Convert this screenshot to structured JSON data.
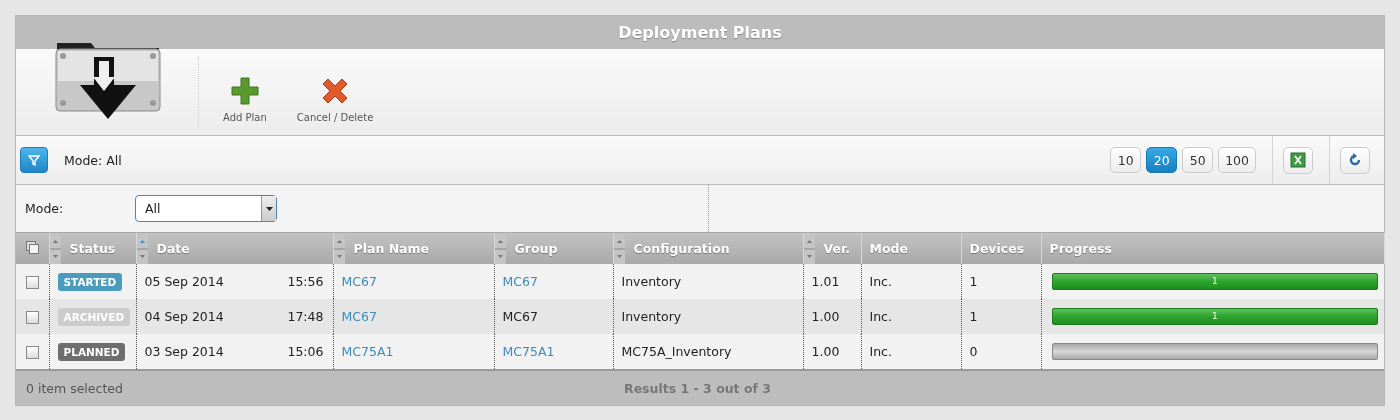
{
  "window": {
    "title": "Deployment Plans"
  },
  "toolbar": [
    {
      "kind": "add",
      "label": "Add Plan"
    },
    {
      "kind": "delete",
      "label": "Cancel / Delete"
    }
  ],
  "filter_bar": {
    "summary": "Mode: All",
    "page_sizes": [
      {
        "label": "10",
        "selected": false
      },
      {
        "label": "20",
        "selected": true
      },
      {
        "label": "50",
        "selected": false
      },
      {
        "label": "100",
        "selected": false
      }
    ]
  },
  "mode_filter": {
    "label": "Mode:",
    "value": "All"
  },
  "table": {
    "columns": [
      {
        "label": "Status",
        "sortable": true,
        "sorted": false
      },
      {
        "label": "Date",
        "sortable": true,
        "sorted": true
      },
      {
        "label": "Plan Name",
        "sortable": true,
        "sorted": false
      },
      {
        "label": "Group",
        "sortable": true,
        "sorted": false
      },
      {
        "label": "Configuration",
        "sortable": true,
        "sorted": false
      },
      {
        "label": "Ver.",
        "sortable": true,
        "sorted": false
      },
      {
        "label": "Mode",
        "sortable": false
      },
      {
        "label": "Devices",
        "sortable": false
      },
      {
        "label": "Progress",
        "sortable": false
      }
    ],
    "rows": [
      {
        "checked": false,
        "status": "STARTED",
        "color": "#4a9bbd",
        "date": "05 Sep 2014",
        "time": "15:56",
        "plan_name": "MC67",
        "group": "MC67",
        "group_link": true,
        "configuration": "Inventory",
        "version": "1.01",
        "mode": "Inc.",
        "devices": "1",
        "progress": {
          "complete": true,
          "label": "1"
        }
      },
      {
        "checked": false,
        "status": "ARCHIVED",
        "color": "#cccccc",
        "date": "04 Sep 2014",
        "time": "17:48",
        "plan_name": "MC67",
        "group": "MC67",
        "group_link": false,
        "configuration": "Inventory",
        "version": "1.00",
        "mode": "Inc.",
        "devices": "1",
        "progress": {
          "complete": true,
          "label": "1"
        }
      },
      {
        "checked": false,
        "status": "PLANNED",
        "color": "#6e6e6e",
        "date": "03 Sep 2014",
        "time": "15:06",
        "plan_name": "MC75A1",
        "group": "MC75A1",
        "group_link": true,
        "configuration": "MC75A_Inventory",
        "version": "1.00",
        "mode": "Inc.",
        "devices": "0",
        "progress": {
          "complete": false
        }
      }
    ]
  },
  "status_bar": {
    "selection": "0 item selected",
    "results": "Results 1 - 3 out of 3"
  }
}
